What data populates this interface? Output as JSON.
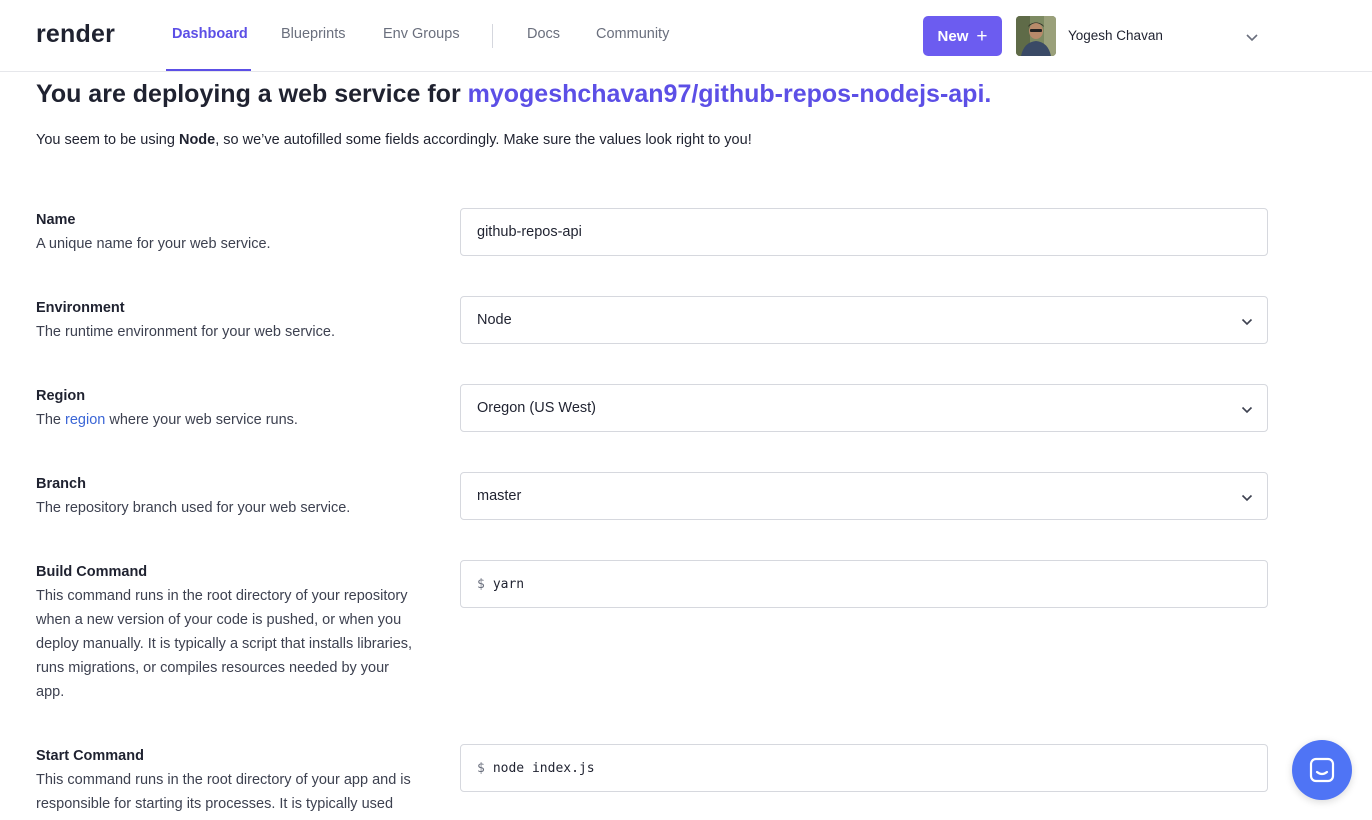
{
  "header": {
    "logo": "render",
    "nav": [
      {
        "label": "Dashboard",
        "active": true
      },
      {
        "label": "Blueprints"
      },
      {
        "label": "Env Groups"
      },
      {
        "label": "Docs"
      },
      {
        "label": "Community"
      }
    ],
    "new_button": "New",
    "new_button_icon": "+",
    "user_name": "Yogesh Chavan"
  },
  "main": {
    "title_prefix": "You are deploying a web service for ",
    "title_repo": "myogeshchavan97/github-repos-nodejs-api.",
    "subtitle_prefix": "You seem to be using ",
    "subtitle_env": "Node",
    "subtitle_suffix": ", so we’ve autofilled some fields accordingly. Make sure the values look right to you!"
  },
  "form": {
    "name": {
      "label": "Name",
      "description": "A unique name for your web service.",
      "value": "github-repos-api"
    },
    "environment": {
      "label": "Environment",
      "description": "The runtime environment for your web service.",
      "value": "Node"
    },
    "region": {
      "label": "Region",
      "description_prefix": "The ",
      "description_link": "region",
      "description_suffix": " where your web service runs.",
      "value": "Oregon (US West)"
    },
    "branch": {
      "label": "Branch",
      "description": "The repository branch used for your web service.",
      "value": "master"
    },
    "build_command": {
      "label": "Build Command",
      "description": "This command runs in the root directory of your repository when a new version of your code is pushed, or when you deploy manually. It is typically a script that installs libraries, runs migrations, or compiles resources needed by your app.",
      "prompt": "$",
      "value": "yarn"
    },
    "start_command": {
      "label": "Start Command",
      "description": "This command runs in the root directory of your app and is responsible for starting its processes. It is typically used",
      "prompt": "$",
      "value": "node index.js"
    }
  },
  "colors": {
    "accent": "#5c4fe6",
    "new_button_bg": "#6c5cf0",
    "link": "#3b66d6",
    "chat_bubble": "#4f74f5"
  },
  "icons": {
    "select_chevron": "chevron-down-icon",
    "user_menu": "chevron-down-icon",
    "chat": "chat-icon"
  }
}
